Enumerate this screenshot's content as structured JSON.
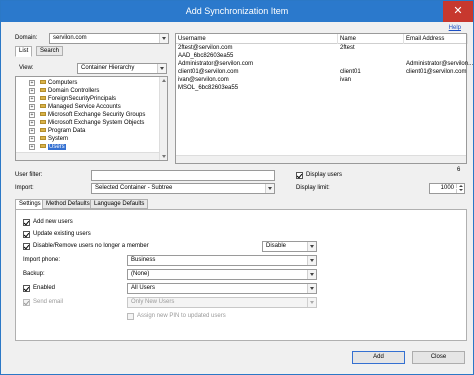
{
  "window": {
    "title": "Add Synchronization Item",
    "close_glyph": "✕",
    "help_label": "Help"
  },
  "source": {
    "domain_label": "Domain:",
    "domain_value": "servilon.com",
    "tabs": [
      "List",
      "Search"
    ],
    "view_label": "View:",
    "view_value": "Container Hierarchy",
    "tree": [
      {
        "label": "Computers",
        "selected": false
      },
      {
        "label": "Domain Controllers",
        "selected": false
      },
      {
        "label": "ForeignSecurityPrincipals",
        "selected": false
      },
      {
        "label": "Managed Service Accounts",
        "selected": false
      },
      {
        "label": "Microsoft Exchange Security Groups",
        "selected": false
      },
      {
        "label": "Microsoft Exchange System Objects",
        "selected": false
      },
      {
        "label": "Program Data",
        "selected": false
      },
      {
        "label": "System",
        "selected": false
      },
      {
        "label": "Users",
        "selected": true
      }
    ]
  },
  "users_grid": {
    "columns": [
      "Username",
      "Name",
      "Email Address"
    ],
    "rows": [
      [
        "2ftest@servilon.com",
        "2ftest",
        ""
      ],
      [
        "AAD_6bc82603ea55",
        "",
        ""
      ],
      [
        "Administrator@servilon.com",
        "",
        "Administrator@servilon..."
      ],
      [
        "client01@servilon.com",
        "client01",
        "client01@servilon.com"
      ],
      [
        "ivan@servilon.com",
        "ivan",
        ""
      ],
      [
        "MSOL_6bc82603ea55",
        "",
        ""
      ]
    ],
    "count": "6"
  },
  "filters": {
    "user_filter_label": "User filter:",
    "user_filter_value": "",
    "display_users_label": "Display users",
    "display_users_checked": true,
    "import_label": "Import:",
    "import_value": "Selected Container - Subtree",
    "display_limit_label": "Display limit:",
    "display_limit_value": "1000"
  },
  "settings_tabs": [
    "Settings",
    "Method Defaults",
    "Language Defaults"
  ],
  "settings": {
    "add_new_users": {
      "label": "Add new users",
      "checked": true
    },
    "update_existing": {
      "label": "Update existing users",
      "checked": true
    },
    "disable_remove": {
      "label": "Disable/Remove users no longer a member",
      "checked": true,
      "value": "Disable"
    },
    "import_phone_label": "Import phone:",
    "import_phone_value": "Business",
    "backup_label": "Backup:",
    "backup_value": "(None)",
    "enabled": {
      "label": "Enabled",
      "checked": true,
      "value": "All Users"
    },
    "send_email": {
      "label": "Send email",
      "checked": true,
      "value": "Only New Users"
    },
    "assign_pin": {
      "label": "Assign new PIN to updated users",
      "checked": false
    }
  },
  "buttons": {
    "add": "Add",
    "close": "Close"
  },
  "colors": {
    "titlebar": "#2b79cc",
    "close_button": "#c7382e",
    "selection": "#3470d1",
    "link": "#1b4fc4"
  }
}
